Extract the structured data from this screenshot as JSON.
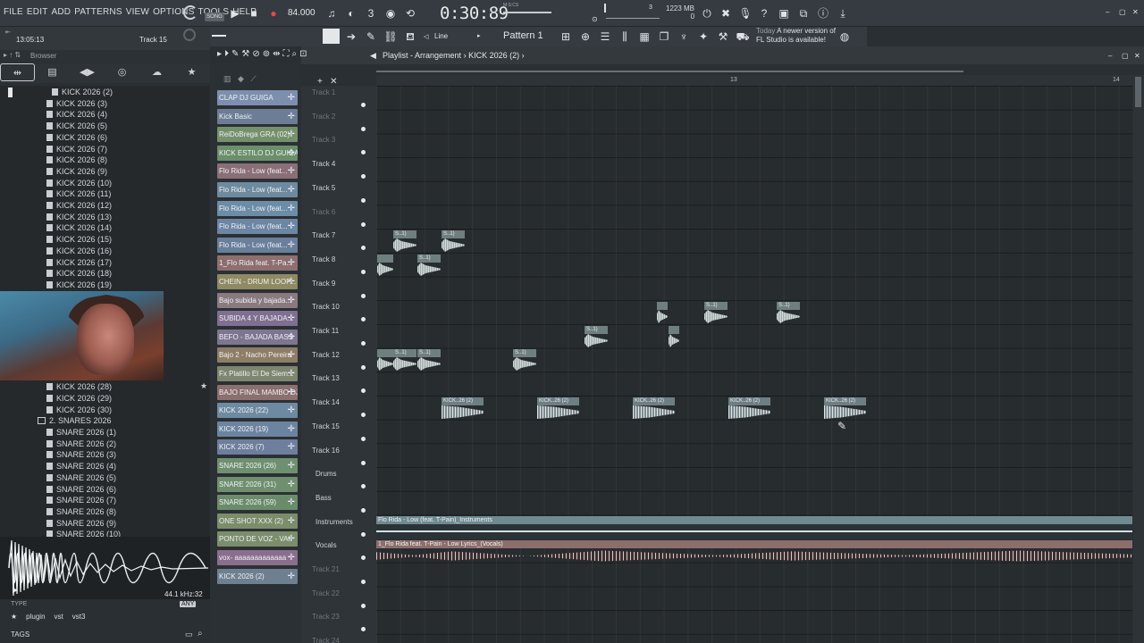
{
  "menu": [
    "FILE",
    "EDIT",
    "ADD",
    "PATTERNS",
    "VIEW",
    "OPTIONS",
    "TOOLS",
    "HELP"
  ],
  "transport": {
    "mode_label": "SONG",
    "tempo": "84.000",
    "time": "0:30:89",
    "time_unit": "M:S:CS",
    "cpu_value": "3",
    "memory": "1223 MB",
    "poly": "0"
  },
  "toolbar2": {
    "line_mode": "Line",
    "pattern": "Pattern 1",
    "news_label": "Today",
    "news_text_1": "A newer version of",
    "news_text_2": "FL Studio is available!"
  },
  "left_header": {
    "clock": "13:05:13",
    "hint": "Track 15"
  },
  "browser": {
    "title": "Browser",
    "tabs": [
      "all-icon",
      "file-icon",
      "plugin-icon",
      "globe-icon",
      "cloud-icon",
      "star-icon"
    ],
    "items_top": [
      "KICK 2026 (2)",
      "KICK 2026 (3)",
      "KICK 2026 (4)",
      "KICK 2026 (5)",
      "KICK 2026 (6)",
      "KICK 2026 (7)",
      "KICK 2026 (8)",
      "KICK 2026 (9)",
      "KICK 2026 (10)",
      "KICK 2026 (11)",
      "KICK 2026 (12)",
      "KICK 2026 (13)",
      "KICK 2026 (14)",
      "KICK 2026 (15)",
      "KICK 2026 (16)",
      "KICK 2026 (17)",
      "KICK 2026 (18)",
      "KICK 2026 (19)"
    ],
    "items_bottom": [
      "KICK 2026 (28)",
      "KICK 2026 (29)",
      "KICK 2026 (30)"
    ],
    "folder": "2. SNARES 2026",
    "snares": [
      "SNARE 2026 (1)",
      "SNARE 2026 (2)",
      "SNARE 2026 (3)",
      "SNARE 2026 (4)",
      "SNARE 2026 (5)",
      "SNARE 2026 (6)",
      "SNARE 2026 (7)",
      "SNARE 2026 (8)",
      "SNARE 2026 (9)",
      "SNARE 2026 (10)"
    ],
    "sample_rate": "44.1 kHz:32",
    "type_label": "TYPE",
    "any_label": "ANY",
    "plugin_tags": [
      "plugin",
      "vst",
      "vst3"
    ],
    "tags_label": "TAGS"
  },
  "clips": [
    {
      "name": "CLAP DJ GUIGA",
      "color": "#7d8fae"
    },
    {
      "name": "Kick Basic",
      "color": "#6c7d95"
    },
    {
      "name": "ReiDoBrega GRA (02)",
      "color": "#75916c"
    },
    {
      "name": "KICK ESTILO DJ GUIGA",
      "color": "#6b8f6a"
    },
    {
      "name": "Flo Rida - Low (feat...",
      "color": "#8a6f78"
    },
    {
      "name": "Flo Rida - Low (feat...",
      "color": "#6e8aa0"
    },
    {
      "name": "Flo Rida - Low (feat...",
      "color": "#6d8ca7"
    },
    {
      "name": "Flo Rida - Low (feat...",
      "color": "#6c86a3"
    },
    {
      "name": "Flo Rida - Low (feat...",
      "color": "#6a7f9b"
    },
    {
      "name": "1_Flo Rida feat. T-Pa...",
      "color": "#8e6f6f"
    },
    {
      "name": "CHEIN - DRUM LOOP...",
      "color": "#8f8a62"
    },
    {
      "name": "Bajo subida y bajada...",
      "color": "#8a7a80"
    },
    {
      "name": "SUBIDA 4 Y BAJADA...",
      "color": "#7f6f90"
    },
    {
      "name": "BEFO - BAJADA BASS",
      "color": "#7e7690"
    },
    {
      "name": "Bajo 2 - Nacho Pereira",
      "color": "#8e7e66"
    },
    {
      "name": "Fx Platillo El De Siem...",
      "color": "#7f8670"
    },
    {
      "name": "BAJO FINAL MAMBO DJ...",
      "color": "#8c6f6f"
    },
    {
      "name": "KICK 2026 (22)",
      "color": "#6e8aa0"
    },
    {
      "name": "KICK 2026 (19)",
      "color": "#6c84a0"
    },
    {
      "name": "KICK 2026 (7)",
      "color": "#6d7f9c"
    },
    {
      "name": "SNARE 2026 (26)",
      "color": "#6f9070"
    },
    {
      "name": "SNARE 2026 (31)",
      "color": "#6f8f6f"
    },
    {
      "name": "SNARE 2026 (59)",
      "color": "#6b8c6b"
    },
    {
      "name": "ONE SHOT XXX (2)",
      "color": "#7c8d6a"
    },
    {
      "name": "PONTO DE VOZ - VAI",
      "color": "#7b8e6c"
    },
    {
      "name": "vox- aaaaaaaaaaaaa",
      "color": "#8a6f8c"
    },
    {
      "name": "KICK 2026 (2)",
      "color": "#6e8090"
    }
  ],
  "playlist": {
    "title": "Playlist - Arrangement",
    "breadcrumb": "KICK 2026 (2)",
    "ruler_marks": [
      "13",
      "14"
    ],
    "tracks": [
      "Track 1",
      "Track 2",
      "Track 3",
      "Track 4",
      "Track 5",
      "Track 6",
      "Track 7",
      "Track 8",
      "Track 9",
      "Track 10",
      "Track 11",
      "Track 12",
      "Track 13",
      "Track 14",
      "Track 15",
      "Track 16",
      "Drums",
      "Bass",
      "Instruments",
      "Vocals",
      "Track 21",
      "Track 22",
      "Track 23",
      "Track 24"
    ],
    "kick_clip_label": "KICK..26 (2)",
    "small_clip_label": "S..1)",
    "lane_instruments": "Flo Rida - Low (feat. T-Pain)_Instruments",
    "lane_vocals": "1_Flo Rida feat. T-Pain - Low Lyrics_(Vocals)"
  }
}
